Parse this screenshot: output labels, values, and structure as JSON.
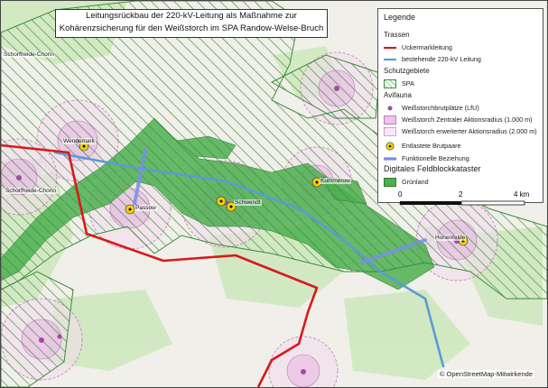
{
  "title": {
    "line1": "Leitungsrückbau der 220-kV-Leitung als Maßnahme zur",
    "line2": "Kohärenzsicherung für den Weißstorch im SPA Randow-Welse-Bruch"
  },
  "legend": {
    "heading": "Legende",
    "sections": {
      "trassen": "Trassen",
      "schutzgebiete": "Schutzgebiete",
      "avifauna": "Avifauna",
      "feldblock": "Digitales Feldblockkataster"
    },
    "items": {
      "uckermark": "Uckermarkleitung",
      "bestehende": "bestehende 220-kV Leitung",
      "spa": "SPA",
      "brutplaetze": "Weißstorchbrutplätze (LfU)",
      "zentral": "Weißstorch Zentraler Aktionsradius (1.000 m)",
      "erweitert": "Weißstorch erweiterter Aktionsradius (2.000 m)",
      "entlastete": "Entlastete Brutpaare",
      "funktionell": "Funktionelle Beziehung",
      "gruenland": "Grünland"
    },
    "colors": {
      "uckermark": "#d71a1a",
      "bestehende": "#5b9bd5",
      "spa_hatch": "#3a8d3a",
      "brutplatz": "#a349a4",
      "zentral_fill": "#ecc6e8",
      "erweitert_stroke": "#c07ab8",
      "entlastet": "#f2d100",
      "funktionell": "#7b8ee6",
      "gruenland": "#4caf50"
    }
  },
  "scale": {
    "zero": "0",
    "two": "2",
    "four": "4 km"
  },
  "places": {
    "wendemark": "Wendemark",
    "schorfheide1": "Schorfheide-Chorin",
    "schorfheide2": "Schorfheide-Chorin",
    "passow": "Passow",
    "schwendt": "Schwendt",
    "kummerow": "Kummerow",
    "hohenfelde": "Hohenfelde"
  },
  "attribution": "© OpenStreetMap-Mitwirkende"
}
